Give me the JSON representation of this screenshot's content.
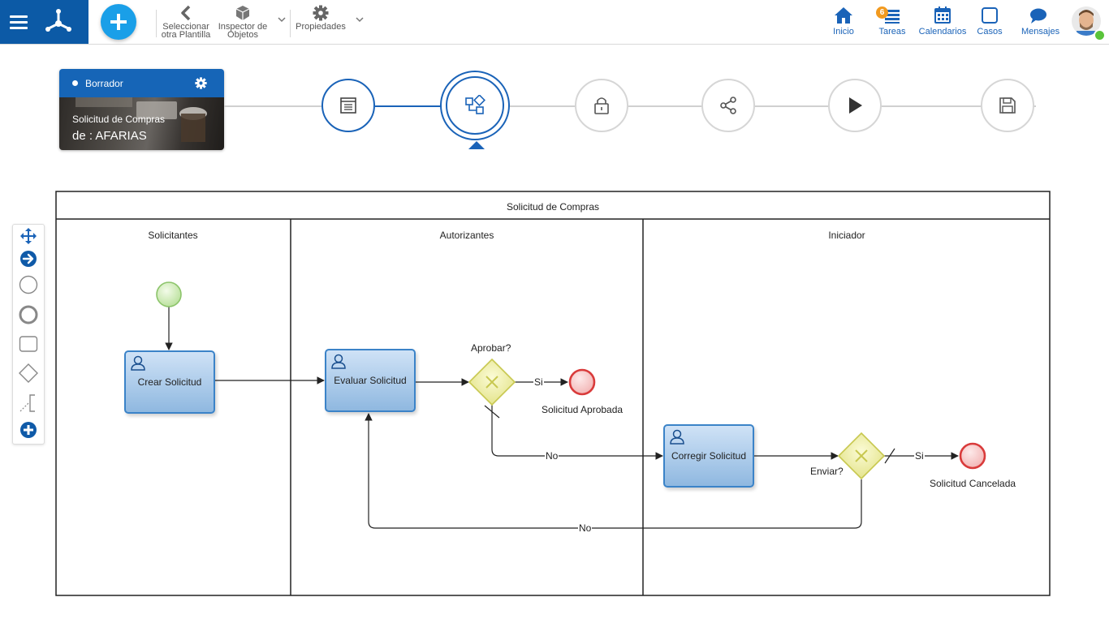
{
  "toolbar": {
    "seleccionar_line1": "Seleccionar",
    "seleccionar_line2": "otra Plantilla",
    "inspector_line1": "Inspector de",
    "inspector_line2": "Objetos",
    "propiedades": "Propiedades"
  },
  "nav": {
    "inicio": "Inicio",
    "tareas": "Tareas",
    "tareas_badge": "6",
    "calendarios": "Calendarios",
    "casos": "Casos",
    "mensajes": "Mensajes"
  },
  "card": {
    "status": "Borrador",
    "title": "Solicitud de Compras",
    "author": "de : AFARIAS"
  },
  "wizard": {
    "steps": [
      "form-icon",
      "process-icon",
      "lock-icon",
      "share-icon",
      "play-icon",
      "save-icon"
    ],
    "active_step": 2
  },
  "diagram": {
    "pool_title": "Solicitud de Compras",
    "lanes": [
      "Solicitantes",
      "Autorizantes",
      "Iniciador"
    ],
    "tasks": {
      "crear": "Crear Solicitud",
      "evaluar": "Evaluar Solicitud",
      "corregir": "Corregir Solicitud"
    },
    "gateways": {
      "aprobar": "Aprobar?",
      "enviar": "Enviar?"
    },
    "events": {
      "aprobada": "Solicitud Aprobada",
      "cancelada": "Solicitud Cancelada"
    },
    "flow_labels": {
      "si1": "Si",
      "no1": "No",
      "si2": "Si",
      "no2": "No"
    }
  },
  "colors": {
    "brand": "#0c5aa6",
    "accent": "#1a9fe8",
    "link": "#1a63b8"
  }
}
